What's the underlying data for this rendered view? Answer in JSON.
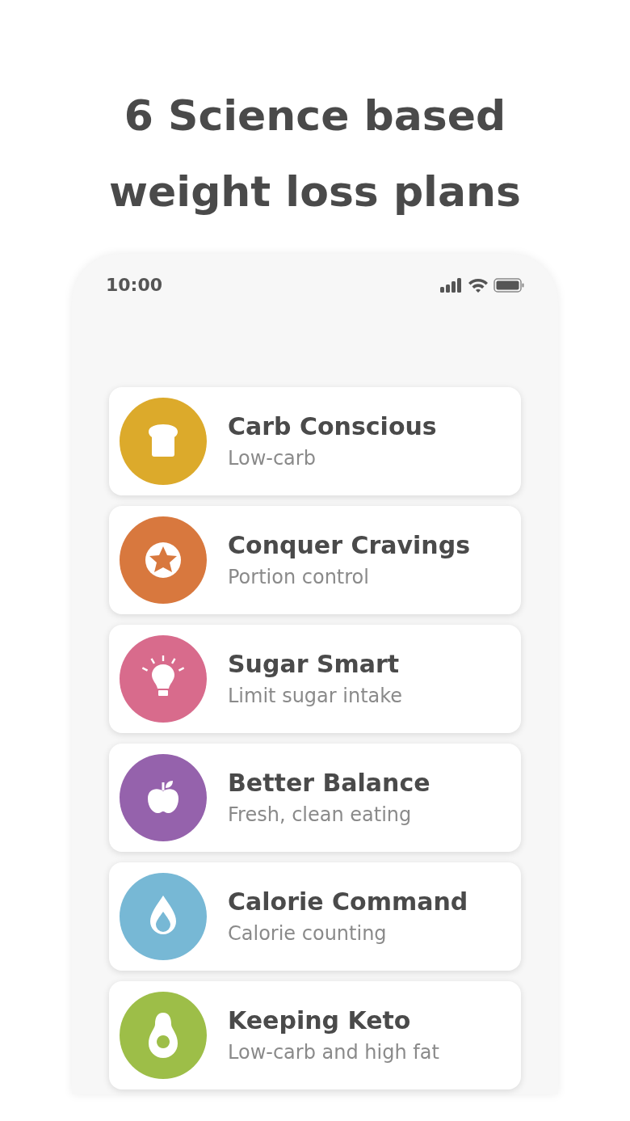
{
  "headline": "6 Science based weight loss plans",
  "status_bar": {
    "time": "10:00"
  },
  "plans": [
    {
      "kind": "bread",
      "color": "#dcaa2b",
      "title": "Carb Conscious",
      "subtitle": "Low-carb"
    },
    {
      "kind": "star",
      "color": "#d8783e",
      "title": "Conquer Cravings",
      "subtitle": "Portion control"
    },
    {
      "kind": "bulb",
      "color": "#d86b8c",
      "title": "Sugar Smart",
      "subtitle": "Limit sugar intake"
    },
    {
      "kind": "apple",
      "color": "#9562ac",
      "title": "Better Balance",
      "subtitle": "Fresh, clean eating"
    },
    {
      "kind": "drop",
      "color": "#77b8d5",
      "title": "Calorie Command",
      "subtitle": "Calorie counting"
    },
    {
      "kind": "avocado",
      "color": "#9dbe48",
      "title": "Keeping Keto",
      "subtitle": "Low-carb and high fat"
    }
  ]
}
